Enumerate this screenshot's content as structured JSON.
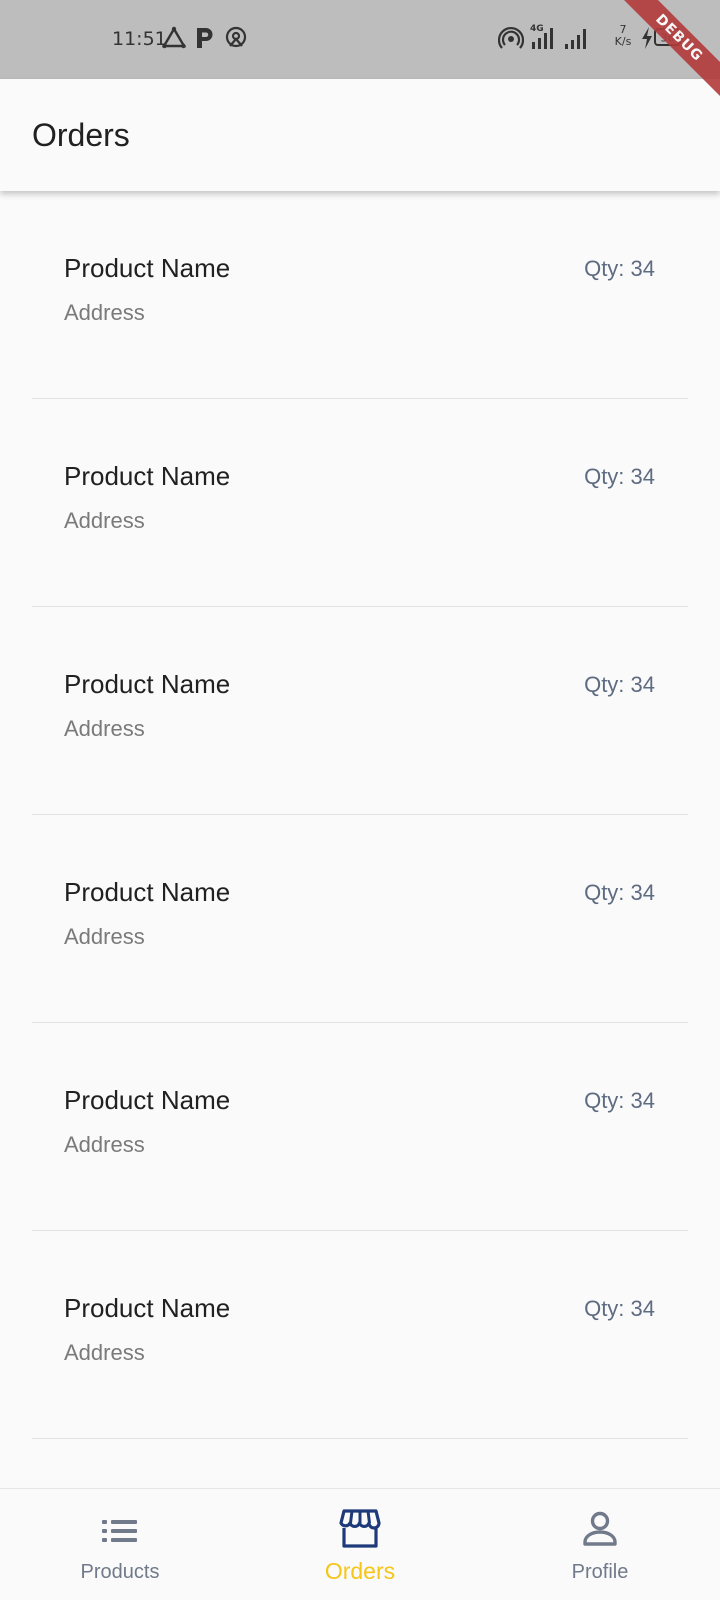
{
  "status_bar": {
    "time": "11:51",
    "network_type": "4G",
    "speed_value": "7",
    "speed_unit": "K/s",
    "battery": "36",
    "debug_label": "DEBUG"
  },
  "app_bar": {
    "title": "Orders"
  },
  "orders": [
    {
      "product_name": "Product Name",
      "address": "Address",
      "qty": "Qty: 34"
    },
    {
      "product_name": "Product Name",
      "address": "Address",
      "qty": "Qty: 34"
    },
    {
      "product_name": "Product Name",
      "address": "Address",
      "qty": "Qty: 34"
    },
    {
      "product_name": "Product Name",
      "address": "Address",
      "qty": "Qty: 34"
    },
    {
      "product_name": "Product Name",
      "address": "Address",
      "qty": "Qty: 34"
    },
    {
      "product_name": "Product Name",
      "address": "Address",
      "qty": "Qty: 34"
    }
  ],
  "bottom_nav": {
    "items": [
      {
        "label": "Products",
        "icon": "list-icon",
        "active": false
      },
      {
        "label": "Orders",
        "icon": "storefront-icon",
        "active": true
      },
      {
        "label": "Profile",
        "icon": "person-icon",
        "active": false
      }
    ]
  },
  "colors": {
    "accent": "#f5c518",
    "active_icon": "#1f3a7a",
    "inactive": "#707a8a",
    "status_bar_bg": "#bdbdbd",
    "debug_ribbon": "#b23b3b"
  }
}
